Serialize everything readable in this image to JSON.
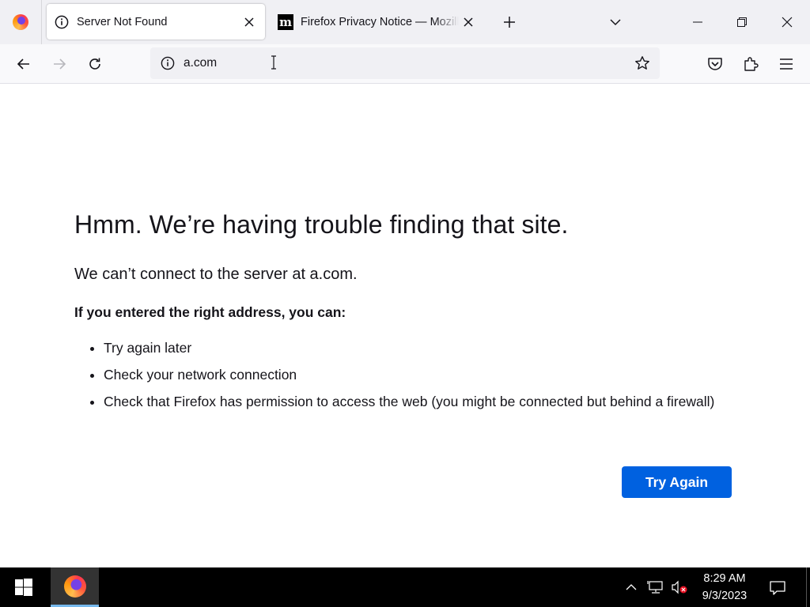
{
  "tabs": [
    {
      "title": "Server Not Found",
      "icon": "info-icon",
      "active": true
    },
    {
      "title": "Firefox Privacy Notice — Mozilla",
      "icon": "mozilla-m-icon",
      "active": false
    }
  ],
  "mozilla_icon_letter": "m",
  "address_bar": {
    "url": "a.com"
  },
  "error_page": {
    "title": "Hmm. We’re having trouble finding that site.",
    "description": "We can’t connect to the server at a.com.",
    "subheading": "If you entered the right address, you can:",
    "suggestions": [
      "Try again later",
      "Check your network connection",
      "Check that Firefox has permission to access the web (you might be connected but behind a firewall)"
    ],
    "try_again_label": "Try Again"
  },
  "taskbar": {
    "time": "8:29 AM",
    "date": "9/3/2023"
  },
  "colors": {
    "accent_button": "#0061e0",
    "tabstrip_bg": "#f0f0f4",
    "taskbar_bg": "#000000"
  }
}
